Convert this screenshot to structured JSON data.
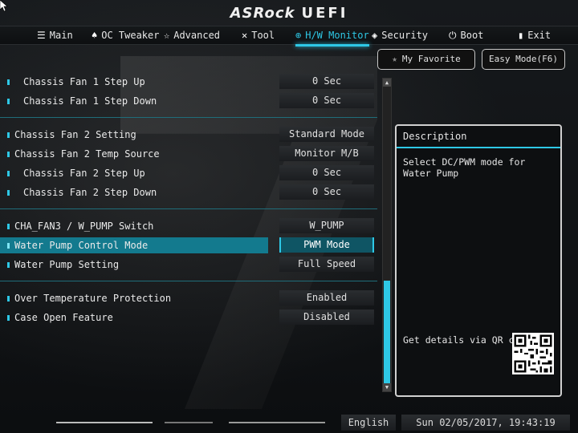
{
  "logo": {
    "brand": "ASRock",
    "product": "UEFI"
  },
  "menu": [
    {
      "label": "Main",
      "icon": "list-icon",
      "active": false
    },
    {
      "label": "OC Tweaker",
      "icon": "flame-icon",
      "active": false
    },
    {
      "label": "Advanced",
      "icon": "star-icon",
      "active": false
    },
    {
      "label": "Tool",
      "icon": "tools-icon",
      "active": false
    },
    {
      "label": "H/W Monitor",
      "icon": "globe-icon",
      "active": true
    },
    {
      "label": "Security",
      "icon": "shield-icon",
      "active": false
    },
    {
      "label": "Boot",
      "icon": "power-icon",
      "active": false
    },
    {
      "label": "Exit",
      "icon": "exit-icon",
      "active": false
    }
  ],
  "buttons": {
    "favorite": "My Favorite",
    "easy_mode": "Easy Mode(F6)"
  },
  "settings": [
    {
      "label": "Chassis Fan 1 Step Up",
      "value": "0 Sec",
      "indent": true
    },
    {
      "label": "Chassis Fan 1 Step Down",
      "value": "0 Sec",
      "indent": true
    },
    {
      "label": "Chassis Fan 2 Setting",
      "value": "Standard Mode",
      "indent": false
    },
    {
      "label": "Chassis Fan 2 Temp Source",
      "value": "Monitor M/B",
      "indent": false
    },
    {
      "label": "Chassis Fan 2 Step Up",
      "value": "0 Sec",
      "indent": true
    },
    {
      "label": "Chassis Fan 2 Step Down",
      "value": "0 Sec",
      "indent": true
    },
    {
      "label": "CHA_FAN3 / W_PUMP Switch",
      "value": "W_PUMP",
      "indent": false
    },
    {
      "label": "Water Pump Control Mode",
      "value": "PWM Mode",
      "indent": false,
      "selected": true
    },
    {
      "label": "Water Pump Setting",
      "value": "Full Speed",
      "indent": false
    },
    {
      "label": "Over Temperature Protection",
      "value": "Enabled",
      "indent": false
    },
    {
      "label": "Case Open Feature",
      "value": "Disabled",
      "indent": false
    }
  ],
  "description": {
    "title": "Description",
    "text": "Select DC/PWM mode for Water Pump",
    "qr_text": "Get details via QR code"
  },
  "footer": {
    "language": "English",
    "datetime": "Sun 02/05/2017, 19:43:19"
  },
  "colors": {
    "accent": "#2ec8e6",
    "selected_row": "#137a8e",
    "background": "#0a0c0e"
  }
}
